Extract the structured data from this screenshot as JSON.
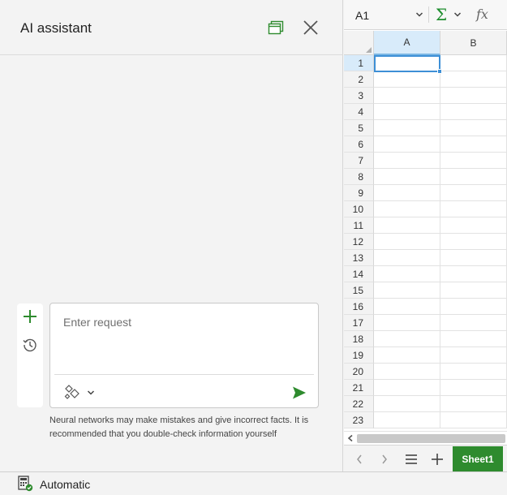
{
  "ai_panel": {
    "title": "AI assistant",
    "popout_icon": "popout-window-icon",
    "close_icon": "close-icon",
    "new_chat_icon": "plus-icon",
    "history_icon": "history-icon",
    "request_placeholder": "Enter request",
    "request_value": "",
    "mode_icon": "sparkle-diamonds-icon",
    "send_icon": "send-arrow-icon",
    "disclaimer": "Neural networks may make mistakes and give incorrect facts. It is recommended that you double-check information yourself"
  },
  "formula_bar": {
    "cell_reference": "A1",
    "sum_icon": "sigma-icon",
    "function_icon": "fx-icon"
  },
  "spreadsheet": {
    "columns": [
      "A",
      "B"
    ],
    "rows": [
      "1",
      "2",
      "3",
      "4",
      "5",
      "6",
      "7",
      "8",
      "9",
      "10",
      "11",
      "12",
      "13",
      "14",
      "15",
      "16",
      "17",
      "18",
      "19",
      "20",
      "21",
      "22",
      "23"
    ],
    "active_cell": "A1"
  },
  "sheet_tabs": {
    "tabs": [
      {
        "label": "Sheet1",
        "active": true
      }
    ]
  },
  "status_bar": {
    "calculation_mode": "Automatic"
  },
  "colors": {
    "accent_green": "#2e8b2e",
    "selection_blue": "#3d8fd6",
    "header_selected": "#d8ebfa"
  }
}
